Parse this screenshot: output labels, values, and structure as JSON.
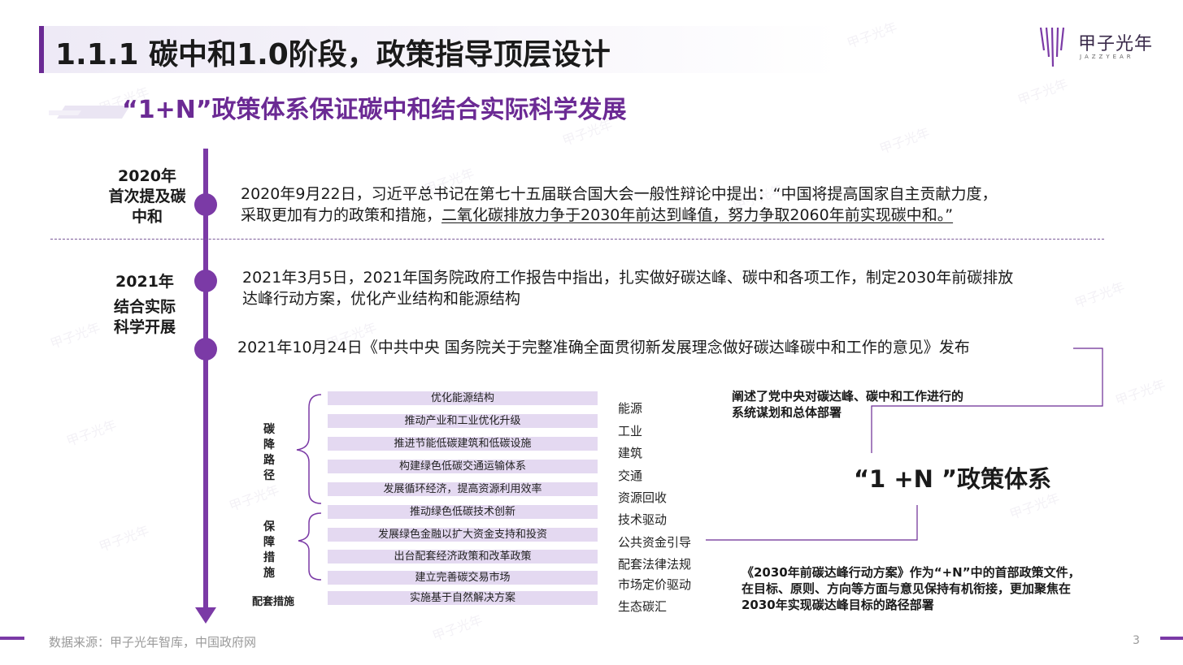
{
  "header": {
    "title": "1.1.1 碳中和1.0阶段，政策指导顶层设计",
    "subtitle": "“1+N”政策体系保证碳中和结合实际科学发展"
  },
  "logo": {
    "name": "甲子光年",
    "sub": "JAZZYEAR"
  },
  "timeline": {
    "year1": {
      "line1": "2020年",
      "line2": "首次提及碳",
      "line3": "中和"
    },
    "year2": {
      "line1": "2021年",
      "line2": "结合实际",
      "line3": "科学开展"
    },
    "event1_line1": "2020年9月22日，习近平总书记在第七十五届联合国大会一般性辩论中提出：“中国将提高国家自主贡献力度，",
    "event1_line2_plain": "采取更加有力的政策和措施，",
    "event1_line2_underlined": "二氧化碳排放力争于2030年前达到峰值，努力争取2060年前实现碳中和。”",
    "event2_line1": "2021年3月5日，2021年国务院政府工作报告中指出，扎实做好碳达峰、碳中和各项工作，制定2030年前碳排放",
    "event2_line2": "达峰行动方案，优化产业结构和能源结构",
    "event3": "2021年10月24日《中共中央 国务院关于完整准确全面贯彻新发展理念做好碳达峰碳中和工作的意见》发布"
  },
  "groups": {
    "path": [
      "碳",
      "降",
      "路",
      "径"
    ],
    "measures": [
      "保",
      "障",
      "措",
      "施"
    ],
    "supporting": "配套措施"
  },
  "bars": [
    "优化能源结构",
    "推动产业和工业优化升级",
    "推进节能低碳建筑和低碳设施",
    "构建绿色低碳交通运输体系",
    "发展循环经济，提高资源利用效率",
    "推动绿色低碳技术创新",
    "发展绿色金融以扩大资金支持和投资",
    "出台配套经济政策和改革政策",
    "建立完善碳交易市场",
    "实施基于自然解决方案"
  ],
  "categories": [
    "能源",
    "工业",
    "建筑",
    "交通",
    "资源回收",
    "技术驱动",
    "公共资金引导",
    "配套法律法规",
    "市场定价驱动",
    "生态碳汇"
  ],
  "notes": {
    "top_line1": "阐述了党中央对碳达峰、碳中和工作进行的",
    "top_line2": "系统谋划和总体部署",
    "policy": "“1 +N ”政策体系",
    "bottom_line1": "《2030年前碳达峰行动方案》作为“+N”中的首部政策文件，",
    "bottom_line2": "在目标、原则、方向等方面与意见保持有机衔接，更加聚焦在",
    "bottom_line3": "2030年实现碳达峰目标的路径部署"
  },
  "footer": {
    "source": "数据来源：甲子光年智库，中国政府网",
    "page": "3"
  },
  "colors": {
    "accent": "#7b3aa6",
    "bar": "#e4d9f1",
    "title_band": "#eeeaf6"
  }
}
